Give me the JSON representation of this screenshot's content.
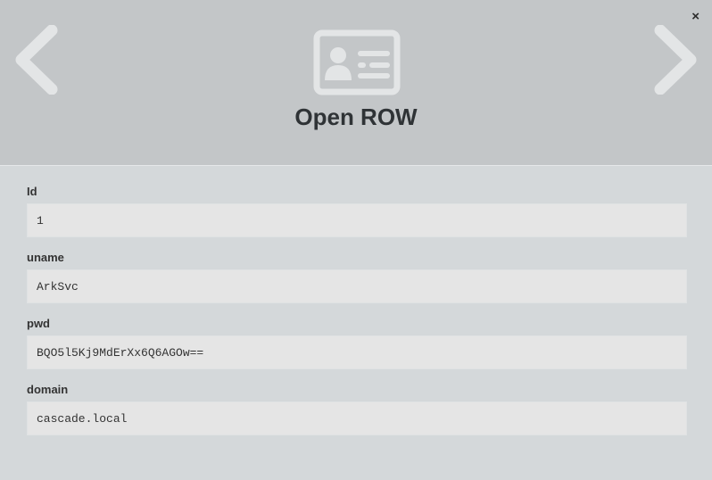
{
  "header": {
    "title": "Open ROW",
    "close_symbol": "×",
    "icons": {
      "close": "close-icon",
      "previous": "chevron-left-icon",
      "next": "chevron-right-icon",
      "record": "id-card-icon"
    }
  },
  "fields": [
    {
      "label": "Id",
      "value": "1"
    },
    {
      "label": "uname",
      "value": "ArkSvc"
    },
    {
      "label": "pwd",
      "value": "BQO5l5Kj9MdErXx6Q6AGOw=="
    },
    {
      "label": "domain",
      "value": "cascade.local"
    }
  ],
  "colors": {
    "header_bg": "#c3c6c8",
    "body_bg": "#d4d8da",
    "input_bg": "#e5e5e5",
    "icon_color": "#e3e5e6"
  }
}
